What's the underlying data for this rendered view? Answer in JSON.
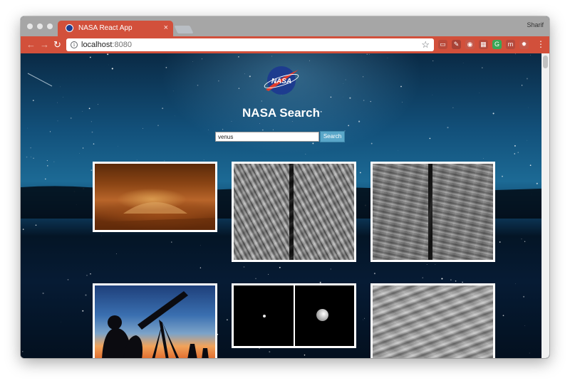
{
  "browser": {
    "tab": {
      "title": "NASA React App",
      "close": "×"
    },
    "profile": "Sharif",
    "nav": {
      "back": "←",
      "forward": "→",
      "reload": "↻"
    },
    "omnibox": {
      "host": "localhost",
      "port": ":8080"
    },
    "info_glyph": "i",
    "star_glyph": "☆",
    "menu_glyph": "⋮",
    "extensions": [
      {
        "name": "ext-1-icon",
        "glyph": "▭",
        "color": "#b94a3a"
      },
      {
        "name": "ext-2-icon",
        "glyph": "✎",
        "color": "#a84236"
      },
      {
        "name": "ext-3-icon",
        "glyph": "◉",
        "color": "#c6594a"
      },
      {
        "name": "ext-4-icon",
        "glyph": "▦",
        "color": "#b54a3d"
      },
      {
        "name": "ext-5-icon",
        "glyph": "G",
        "color": "#3aa757"
      },
      {
        "name": "ext-6-icon",
        "glyph": "m",
        "color": "#b54a3d"
      },
      {
        "name": "ext-7-icon",
        "glyph": "✹",
        "color": "#c6594a"
      }
    ],
    "accent_color": "#d2503b"
  },
  "page": {
    "logo_text": "NASA",
    "title": "NASA Search",
    "search": {
      "value": "venus",
      "button_label": "Search"
    },
    "results": [
      {
        "name": "venus-volcano-orange"
      },
      {
        "name": "venus-radar-split-1"
      },
      {
        "name": "venus-radar-split-2"
      },
      {
        "name": "telescope-silhouette"
      },
      {
        "name": "venus-dots-black"
      },
      {
        "name": "venus-surface-gray"
      }
    ]
  }
}
